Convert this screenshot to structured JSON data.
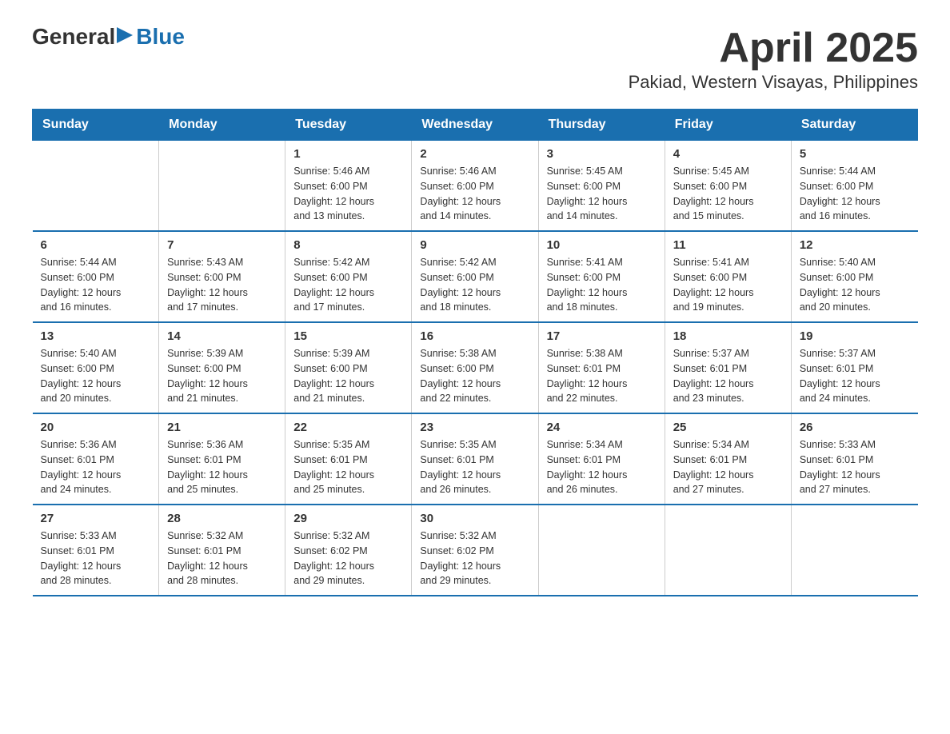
{
  "header": {
    "logo_general": "General",
    "logo_blue": "Blue",
    "month_title": "April 2025",
    "location": "Pakiad, Western Visayas, Philippines"
  },
  "calendar": {
    "days_of_week": [
      "Sunday",
      "Monday",
      "Tuesday",
      "Wednesday",
      "Thursday",
      "Friday",
      "Saturday"
    ],
    "weeks": [
      [
        {
          "day": "",
          "info": ""
        },
        {
          "day": "",
          "info": ""
        },
        {
          "day": "1",
          "info": "Sunrise: 5:46 AM\nSunset: 6:00 PM\nDaylight: 12 hours\nand 13 minutes."
        },
        {
          "day": "2",
          "info": "Sunrise: 5:46 AM\nSunset: 6:00 PM\nDaylight: 12 hours\nand 14 minutes."
        },
        {
          "day": "3",
          "info": "Sunrise: 5:45 AM\nSunset: 6:00 PM\nDaylight: 12 hours\nand 14 minutes."
        },
        {
          "day": "4",
          "info": "Sunrise: 5:45 AM\nSunset: 6:00 PM\nDaylight: 12 hours\nand 15 minutes."
        },
        {
          "day": "5",
          "info": "Sunrise: 5:44 AM\nSunset: 6:00 PM\nDaylight: 12 hours\nand 16 minutes."
        }
      ],
      [
        {
          "day": "6",
          "info": "Sunrise: 5:44 AM\nSunset: 6:00 PM\nDaylight: 12 hours\nand 16 minutes."
        },
        {
          "day": "7",
          "info": "Sunrise: 5:43 AM\nSunset: 6:00 PM\nDaylight: 12 hours\nand 17 minutes."
        },
        {
          "day": "8",
          "info": "Sunrise: 5:42 AM\nSunset: 6:00 PM\nDaylight: 12 hours\nand 17 minutes."
        },
        {
          "day": "9",
          "info": "Sunrise: 5:42 AM\nSunset: 6:00 PM\nDaylight: 12 hours\nand 18 minutes."
        },
        {
          "day": "10",
          "info": "Sunrise: 5:41 AM\nSunset: 6:00 PM\nDaylight: 12 hours\nand 18 minutes."
        },
        {
          "day": "11",
          "info": "Sunrise: 5:41 AM\nSunset: 6:00 PM\nDaylight: 12 hours\nand 19 minutes."
        },
        {
          "day": "12",
          "info": "Sunrise: 5:40 AM\nSunset: 6:00 PM\nDaylight: 12 hours\nand 20 minutes."
        }
      ],
      [
        {
          "day": "13",
          "info": "Sunrise: 5:40 AM\nSunset: 6:00 PM\nDaylight: 12 hours\nand 20 minutes."
        },
        {
          "day": "14",
          "info": "Sunrise: 5:39 AM\nSunset: 6:00 PM\nDaylight: 12 hours\nand 21 minutes."
        },
        {
          "day": "15",
          "info": "Sunrise: 5:39 AM\nSunset: 6:00 PM\nDaylight: 12 hours\nand 21 minutes."
        },
        {
          "day": "16",
          "info": "Sunrise: 5:38 AM\nSunset: 6:00 PM\nDaylight: 12 hours\nand 22 minutes."
        },
        {
          "day": "17",
          "info": "Sunrise: 5:38 AM\nSunset: 6:01 PM\nDaylight: 12 hours\nand 22 minutes."
        },
        {
          "day": "18",
          "info": "Sunrise: 5:37 AM\nSunset: 6:01 PM\nDaylight: 12 hours\nand 23 minutes."
        },
        {
          "day": "19",
          "info": "Sunrise: 5:37 AM\nSunset: 6:01 PM\nDaylight: 12 hours\nand 24 minutes."
        }
      ],
      [
        {
          "day": "20",
          "info": "Sunrise: 5:36 AM\nSunset: 6:01 PM\nDaylight: 12 hours\nand 24 minutes."
        },
        {
          "day": "21",
          "info": "Sunrise: 5:36 AM\nSunset: 6:01 PM\nDaylight: 12 hours\nand 25 minutes."
        },
        {
          "day": "22",
          "info": "Sunrise: 5:35 AM\nSunset: 6:01 PM\nDaylight: 12 hours\nand 25 minutes."
        },
        {
          "day": "23",
          "info": "Sunrise: 5:35 AM\nSunset: 6:01 PM\nDaylight: 12 hours\nand 26 minutes."
        },
        {
          "day": "24",
          "info": "Sunrise: 5:34 AM\nSunset: 6:01 PM\nDaylight: 12 hours\nand 26 minutes."
        },
        {
          "day": "25",
          "info": "Sunrise: 5:34 AM\nSunset: 6:01 PM\nDaylight: 12 hours\nand 27 minutes."
        },
        {
          "day": "26",
          "info": "Sunrise: 5:33 AM\nSunset: 6:01 PM\nDaylight: 12 hours\nand 27 minutes."
        }
      ],
      [
        {
          "day": "27",
          "info": "Sunrise: 5:33 AM\nSunset: 6:01 PM\nDaylight: 12 hours\nand 28 minutes."
        },
        {
          "day": "28",
          "info": "Sunrise: 5:32 AM\nSunset: 6:01 PM\nDaylight: 12 hours\nand 28 minutes."
        },
        {
          "day": "29",
          "info": "Sunrise: 5:32 AM\nSunset: 6:02 PM\nDaylight: 12 hours\nand 29 minutes."
        },
        {
          "day": "30",
          "info": "Sunrise: 5:32 AM\nSunset: 6:02 PM\nDaylight: 12 hours\nand 29 minutes."
        },
        {
          "day": "",
          "info": ""
        },
        {
          "day": "",
          "info": ""
        },
        {
          "day": "",
          "info": ""
        }
      ]
    ]
  }
}
